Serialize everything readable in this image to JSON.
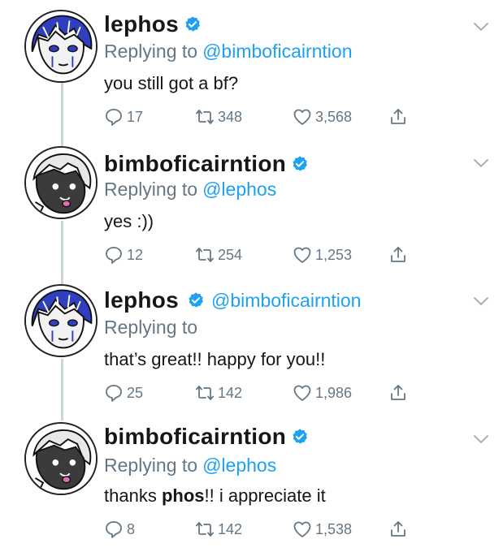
{
  "tweets": [
    {
      "name": "lephos",
      "inline_handle": "",
      "replying_label": "Replying to",
      "replying_handle": "@bimboficairntion",
      "text": "you still got a bf?",
      "text_bold": "",
      "text_after": "",
      "replies": "17",
      "retweets": "348",
      "likes": "3,568",
      "avatar": "blue-haired-character"
    },
    {
      "name": "bimboficairntion",
      "inline_handle": "",
      "replying_label": "Replying to",
      "replying_handle": "@lephos",
      "text": "yes :))",
      "text_bold": "",
      "text_after": "",
      "replies": "12",
      "retweets": "254",
      "likes": "1,253",
      "avatar": "dark-skinned-character"
    },
    {
      "name": "lephos",
      "inline_handle": "@bimboficairntion",
      "replying_label": "Replying to",
      "replying_handle": "",
      "text": "that’s great!! happy for you!!",
      "text_bold": "",
      "text_after": "",
      "replies": "25",
      "retweets": "142",
      "likes": "1,986",
      "avatar": "blue-haired-character"
    },
    {
      "name": "bimboficairntion",
      "inline_handle": "",
      "replying_label": "Replying to",
      "replying_handle": "@lephos",
      "text": "thanks ",
      "text_bold": "phos",
      "text_after": "!! i appreciate it",
      "replies": "8",
      "retweets": "142",
      "likes": "1,538",
      "avatar": "dark-skinned-character"
    }
  ],
  "icons": {
    "reply": "comment-bubble-icon",
    "retweet": "retweet-arrows-icon",
    "like": "heart-icon",
    "share": "share-upload-icon",
    "verified": "verified-badge-icon",
    "menu": "chevron-down-icon"
  },
  "colors": {
    "accent": "#1da1f2",
    "muted": "#657786",
    "text": "#14171a",
    "thread_line": "#ccd6dd"
  }
}
